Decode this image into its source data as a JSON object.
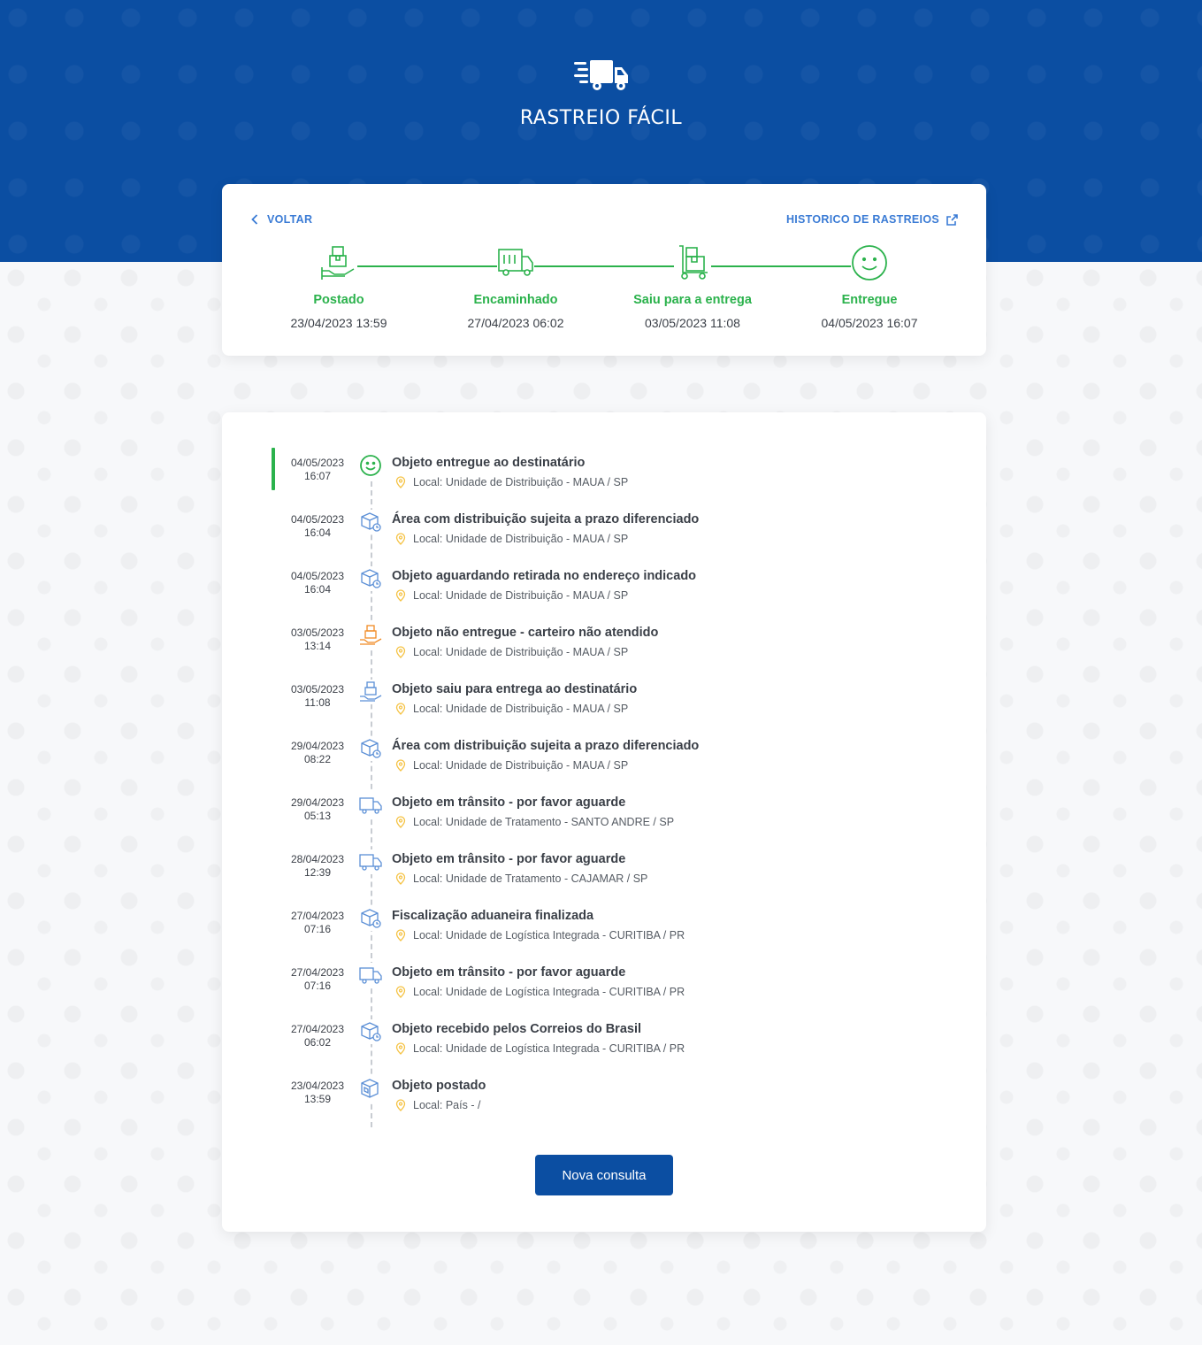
{
  "header": {
    "title": "RASTREIO FÁCIL"
  },
  "nav": {
    "back_label": "VOLTAR",
    "history_label": "HISTORICO DE RASTREIOS"
  },
  "colors": {
    "brand": "#0b4ea2",
    "success": "#2bb24c",
    "link": "#3a7bd5",
    "warning": "#f5a623"
  },
  "steps": [
    {
      "label": "Postado",
      "date": "23/04/2023 13:59",
      "icon": "package-hand-icon"
    },
    {
      "label": "Encaminhado",
      "date": "27/04/2023 06:02",
      "icon": "truck-icon"
    },
    {
      "label": "Saiu para a entrega",
      "date": "03/05/2023 11:08",
      "icon": "hand-truck-icon"
    },
    {
      "label": "Entregue",
      "date": "04/05/2023 16:07",
      "icon": "smiley-icon"
    }
  ],
  "events": [
    {
      "date": "04/05/2023",
      "time": "16:07",
      "title": "Objeto entregue ao destinatário",
      "location": "Local: Unidade de Distribuição - MAUA / SP",
      "icon": "smiley-icon"
    },
    {
      "date": "04/05/2023",
      "time": "16:04",
      "title": "Área com distribuição sujeita a prazo diferenciado",
      "location": "Local: Unidade de Distribuição - MAUA / SP",
      "icon": "box-clock-icon"
    },
    {
      "date": "04/05/2023",
      "time": "16:04",
      "title": "Objeto aguardando retirada no endereço indicado",
      "location": "Local: Unidade de Distribuição - MAUA / SP",
      "icon": "box-clock-icon"
    },
    {
      "date": "03/05/2023",
      "time": "13:14",
      "title": "Objeto não entregue - carteiro não atendido",
      "location": "Local: Unidade de Distribuição - MAUA / SP",
      "icon": "package-hand-warning-icon"
    },
    {
      "date": "03/05/2023",
      "time": "11:08",
      "title": "Objeto saiu para entrega ao destinatário",
      "location": "Local: Unidade de Distribuição - MAUA / SP",
      "icon": "package-hand-icon"
    },
    {
      "date": "29/04/2023",
      "time": "08:22",
      "title": "Área com distribuição sujeita a prazo diferenciado",
      "location": "Local: Unidade de Distribuição - MAUA / SP",
      "icon": "box-clock-icon"
    },
    {
      "date": "29/04/2023",
      "time": "05:13",
      "title": "Objeto em trânsito - por favor aguarde",
      "location": "Local: Unidade de Tratamento - SANTO ANDRE / SP",
      "icon": "truck-icon"
    },
    {
      "date": "28/04/2023",
      "time": "12:39",
      "title": "Objeto em trânsito - por favor aguarde",
      "location": "Local: Unidade de Tratamento - CAJAMAR / SP",
      "icon": "truck-icon"
    },
    {
      "date": "27/04/2023",
      "time": "07:16",
      "title": "Fiscalização aduaneira finalizada",
      "location": "Local: Unidade de Logística Integrada - CURITIBA / PR",
      "icon": "box-clock-icon"
    },
    {
      "date": "27/04/2023",
      "time": "07:16",
      "title": "Objeto em trânsito - por favor aguarde",
      "location": "Local: Unidade de Logística Integrada - CURITIBA / PR",
      "icon": "truck-icon"
    },
    {
      "date": "27/04/2023",
      "time": "06:02",
      "title": "Objeto recebido pelos Correios do Brasil",
      "location": "Local: Unidade de Logística Integrada - CURITIBA / PR",
      "icon": "box-clock-icon"
    },
    {
      "date": "23/04/2023",
      "time": "13:59",
      "title": "Objeto postado",
      "location": "Local: País - /",
      "icon": "box-postal-icon"
    }
  ],
  "button": {
    "label": "Nova consulta"
  }
}
